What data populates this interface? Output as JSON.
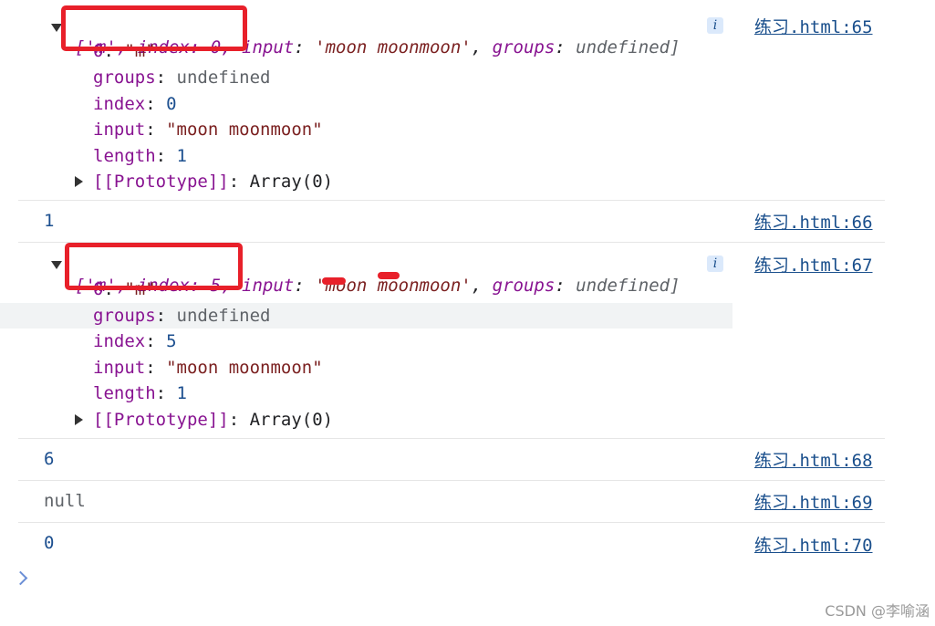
{
  "entries": [
    {
      "summary": {
        "open": "['m', index: 0,",
        "rest_input_key": "input",
        "rest_input_val": "'moon moonmoon'",
        "rest_groups_key": "groups",
        "rest_groups_val": "undefined]"
      },
      "props": [
        {
          "key": "0",
          "value": "\"m\""
        },
        {
          "key": "groups",
          "value": "undefined"
        },
        {
          "key": "index",
          "value": "0"
        },
        {
          "key": "input",
          "value": "\"moon moonmoon\""
        },
        {
          "key": "length",
          "value": "1"
        }
      ],
      "prototype": "[[Prototype]]",
      "prototype_value": "Array(0)",
      "source": "练习.html:65"
    },
    {
      "value": "1",
      "source": "练习.html:66"
    },
    {
      "summary": {
        "open": "['m', index: 5,",
        "rest_input_key": "input",
        "rest_input_val": "'moon moonmoon'",
        "rest_groups_key": "groups",
        "rest_groups_val": "undefined]"
      },
      "props": [
        {
          "key": "0",
          "value": "\"m\""
        },
        {
          "key": "groups",
          "value": "undefined"
        },
        {
          "key": "index",
          "value": "5"
        },
        {
          "key": "input",
          "value": "\"moon moonmoon\""
        },
        {
          "key": "length",
          "value": "1"
        }
      ],
      "prototype": "[[Prototype]]",
      "prototype_value": "Array(0)",
      "source": "练习.html:67"
    },
    {
      "value": "6",
      "source": "练习.html:68"
    },
    {
      "value": "null",
      "source": "练习.html:69"
    },
    {
      "value": "0",
      "source": "练习.html:70"
    }
  ],
  "info_icon": "i",
  "watermark": "CSDN @李喻涵",
  "colors": {
    "highlight": "#e8202a",
    "link": "#1a4f8c",
    "property": "#881391"
  }
}
